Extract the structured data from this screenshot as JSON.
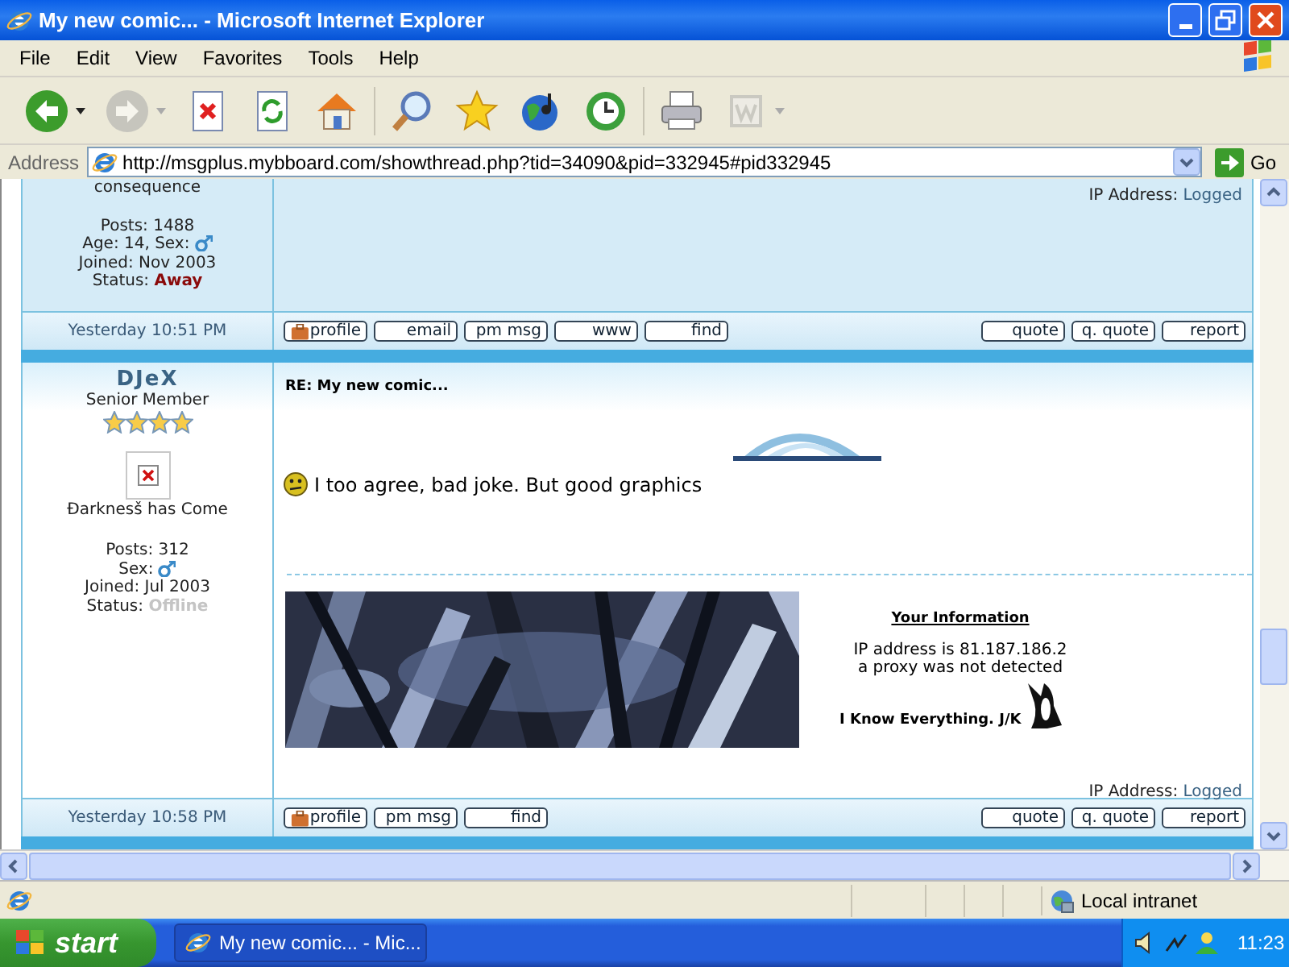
{
  "window": {
    "title": "My new comic... - Microsoft Internet Explorer"
  },
  "menu": [
    "File",
    "Edit",
    "View",
    "Favorites",
    "Tools",
    "Help"
  ],
  "toolbar": [
    [
      {
        "kind": "back",
        "disabled": false,
        "dropdown": true
      },
      {
        "kind": "forward",
        "disabled": true,
        "dropdown": true
      },
      {
        "kind": "stop",
        "disabled": false,
        "dropdown": false
      },
      {
        "kind": "refresh",
        "disabled": false,
        "dropdown": false
      },
      {
        "kind": "home",
        "disabled": false,
        "dropdown": false
      }
    ],
    [
      {
        "kind": "search",
        "disabled": false,
        "dropdown": false
      },
      {
        "kind": "favorites",
        "disabled": false,
        "dropdown": false
      },
      {
        "kind": "media",
        "disabled": false,
        "dropdown": false
      },
      {
        "kind": "history",
        "disabled": false,
        "dropdown": false
      }
    ],
    [
      {
        "kind": "print",
        "disabled": false,
        "dropdown": false
      },
      {
        "kind": "edit",
        "disabled": true,
        "dropdown": true
      }
    ]
  ],
  "address": {
    "label": "Address",
    "url": "http://msgplus.mybboard.com/showthread.php?tid=34090&pid=332945#pid332945",
    "go": "Go"
  },
  "posts": [
    {
      "author": {
        "tagline": "consequence"
      },
      "stats": [
        {
          "kind": "text",
          "text": "Posts: 1488"
        },
        {
          "kind": "gender",
          "text": "Age: 14, Sex:"
        },
        {
          "kind": "text",
          "text": "Joined: Nov 2003"
        },
        {
          "kind": "status",
          "text": "Status:",
          "status": {
            "label": "Away",
            "kind": "away"
          }
        }
      ],
      "ip_label": "IP Address:",
      "ip_value": "Logged",
      "date": "Yesterday 10:51 PM",
      "buttons_left": [
        {
          "kind": "profile",
          "label": "profile"
        },
        {
          "kind": "plain",
          "label": "email"
        },
        {
          "kind": "plain",
          "label": "pm msg"
        },
        {
          "kind": "plain",
          "label": "www"
        },
        {
          "kind": "plain",
          "label": "find"
        }
      ],
      "buttons_right": [
        {
          "label": "quote"
        },
        {
          "label": "q. quote"
        },
        {
          "label": "report"
        }
      ]
    },
    {
      "author": {
        "name": "DJeX",
        "rank": "Senior Member",
        "stars": 4,
        "avatar": {
          "kind": "broken-image"
        },
        "tagline": "Ðarknesš has Come"
      },
      "stats": [
        {
          "kind": "text",
          "text": "Posts: 312"
        },
        {
          "kind": "gender",
          "text": "Sex:"
        },
        {
          "kind": "text",
          "text": "Joined: Jul 2003"
        },
        {
          "kind": "status",
          "text": "Status:",
          "status": {
            "label": "Offline",
            "kind": "offline"
          }
        }
      ],
      "title": "RE: My new comic...",
      "body": [
        {
          "kind": "picture"
        },
        {
          "kind": "smiley-text",
          "text": "I too agree, bad joke. But good graphics"
        }
      ],
      "signature": {
        "banner": {
          "kind": "picture"
        },
        "info_title": "Your Information",
        "info_lines": [
          "IP address is 81.187.186.2",
          "a proxy was not detected"
        ],
        "motto": "I Know Everything. J/K"
      },
      "ip_label": "IP Address:",
      "ip_value": "Logged",
      "date": "Yesterday 10:58 PM",
      "buttons_left": [
        {
          "kind": "profile",
          "label": "profile"
        },
        {
          "kind": "plain",
          "label": "pm msg"
        },
        {
          "kind": "plain",
          "label": "find"
        }
      ],
      "buttons_right": [
        {
          "label": "quote"
        },
        {
          "label": "q. quote"
        },
        {
          "label": "report"
        }
      ]
    }
  ],
  "status_bar": {
    "zone": "Local intranet"
  },
  "taskbar": {
    "start": "start",
    "tasks": [
      {
        "label": "My new comic... - Mic...",
        "selected": true
      }
    ],
    "clock": "11:23"
  }
}
